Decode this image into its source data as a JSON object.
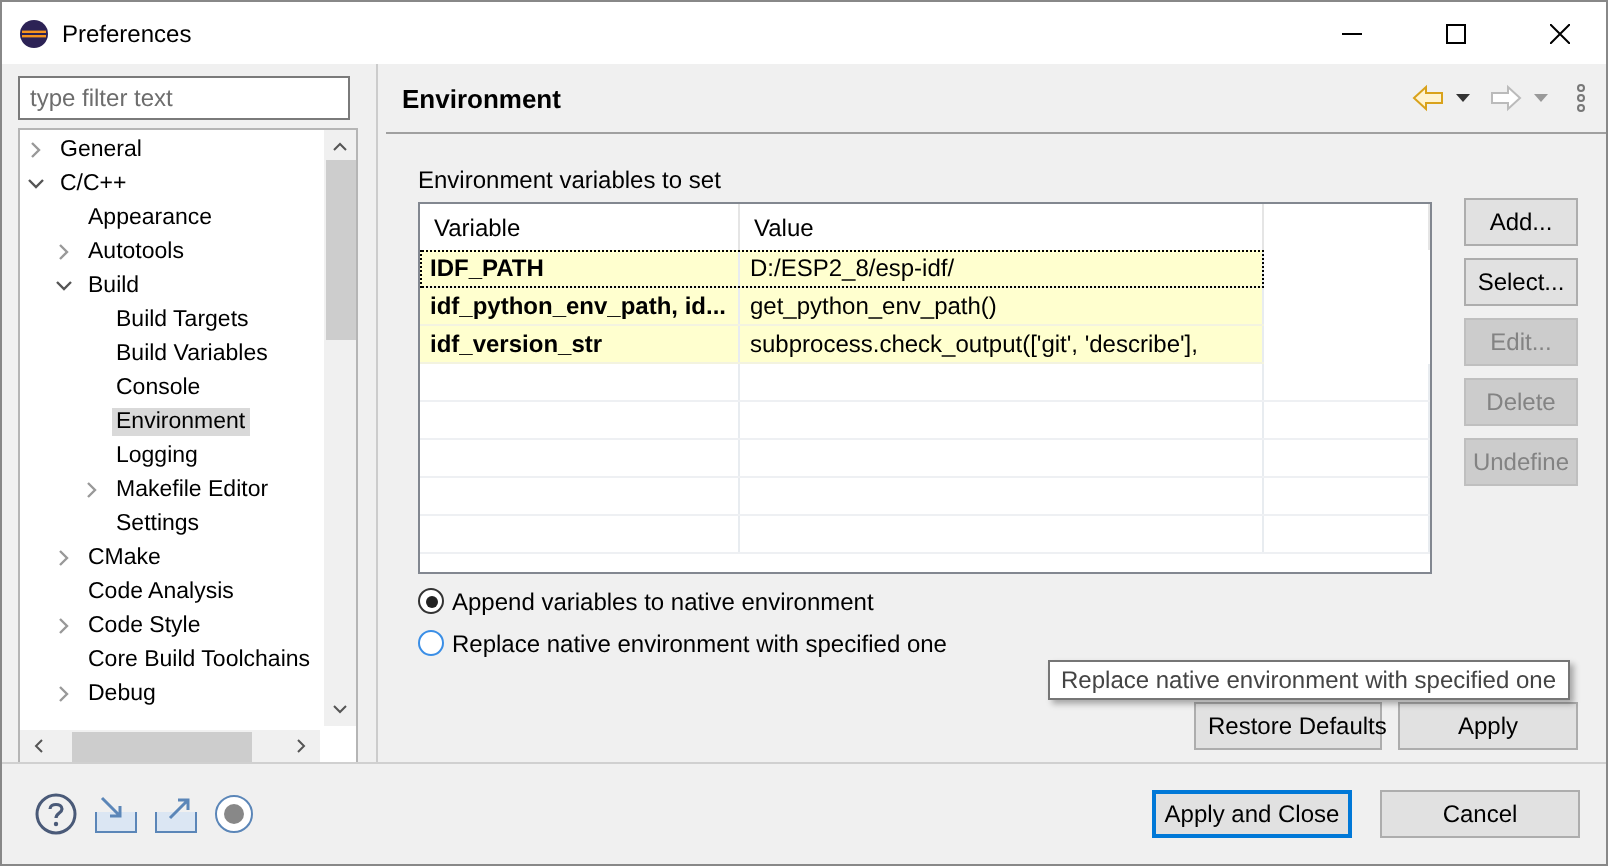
{
  "window": {
    "title": "Preferences"
  },
  "filter": {
    "placeholder": "type filter text"
  },
  "tree": [
    {
      "label": "General",
      "expanded": false,
      "selected": false
    },
    {
      "label": "C/C++",
      "expanded": true,
      "selected": false,
      "children": [
        {
          "label": "Appearance",
          "selected": false
        },
        {
          "label": "Autotools",
          "expanded": false,
          "selected": false
        },
        {
          "label": "Build",
          "expanded": true,
          "selected": false,
          "children": [
            {
              "label": "Build Targets",
              "selected": false
            },
            {
              "label": "Build Variables",
              "selected": false
            },
            {
              "label": "Console",
              "selected": false
            },
            {
              "label": "Environment",
              "selected": true
            },
            {
              "label": "Logging",
              "selected": false
            },
            {
              "label": "Makefile Editor",
              "expanded": false,
              "selected": false
            },
            {
              "label": "Settings",
              "selected": false
            }
          ]
        },
        {
          "label": "CMake",
          "expanded": false,
          "selected": false
        },
        {
          "label": "Code Analysis",
          "selected": false
        },
        {
          "label": "Code Style",
          "expanded": false,
          "selected": false
        },
        {
          "label": "Core Build Toolchains",
          "selected": false
        },
        {
          "label": "Debug",
          "expanded": false,
          "selected": false
        }
      ]
    }
  ],
  "page": {
    "title": "Environment",
    "table_label": "Environment variables to set",
    "columns": [
      "Variable",
      "Value"
    ],
    "rows": [
      {
        "variable": "IDF_PATH",
        "value": "D:/ESP2_8/esp-idf/",
        "selected": true
      },
      {
        "variable": "idf_python_env_path, id...",
        "value": "get_python_env_path()",
        "selected": false
      },
      {
        "variable": "idf_version_str",
        "value": "subprocess.check_output(['git', 'describe'],",
        "selected": false
      }
    ],
    "side_buttons": [
      {
        "label": "Add...",
        "disabled": false
      },
      {
        "label": "Select...",
        "disabled": false
      },
      {
        "label": "Edit...",
        "disabled": true
      },
      {
        "label": "Delete",
        "disabled": true
      },
      {
        "label": "Undefine",
        "disabled": true
      }
    ],
    "options": [
      {
        "label": "Append variables to native environment",
        "selected": true
      },
      {
        "label": "Replace native environment with specified one",
        "selected": false
      }
    ],
    "tooltip": "Replace native environment with specified one",
    "bottom_buttons": [
      "Restore Defaults",
      "Apply"
    ]
  },
  "footer": {
    "buttons": [
      {
        "label": "Apply and Close",
        "default": true
      },
      {
        "label": "Cancel",
        "default": false
      }
    ]
  }
}
